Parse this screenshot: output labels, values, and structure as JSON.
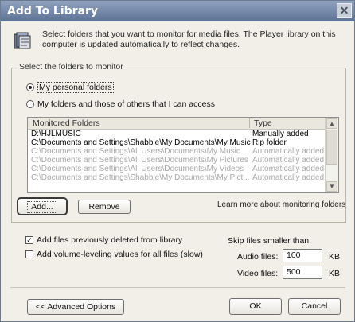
{
  "window": {
    "title": "Add To Library"
  },
  "description": "Select folders that you want to monitor for media files. The Player library on this computer is updated automatically to reflect changes.",
  "group_label": "Select the folders to monitor",
  "radios": [
    {
      "label": "My personal folders",
      "selected": true
    },
    {
      "label": "My folders and those of others that I can access",
      "selected": false
    }
  ],
  "list": {
    "headers": {
      "folder": "Monitored Folders",
      "type": "Type"
    },
    "rows": [
      {
        "folder": "D:\\HJLMUSIC",
        "type": "Manually added",
        "dim": false
      },
      {
        "folder": "C:\\Documents and Settings\\Shabble\\My Documents\\My Music",
        "type": "Rip folder",
        "dim": false
      },
      {
        "folder": "C:\\Documents and Settings\\All Users\\Documents\\My Music",
        "type": "Automatically added",
        "dim": true
      },
      {
        "folder": "C:\\Documents and Settings\\All Users\\Documents\\My Pictures",
        "type": "Automatically added",
        "dim": true
      },
      {
        "folder": "C:\\Documents and Settings\\All Users\\Documents\\My Videos",
        "type": "Automatically added",
        "dim": true
      },
      {
        "folder": "C:\\Documents and Settings\\Shabble\\My Documents\\My Pict...",
        "type": "Automatically added",
        "dim": true
      }
    ]
  },
  "buttons": {
    "add": "Add...",
    "remove": "Remove",
    "advanced": "<< Advanced Options",
    "ok": "OK",
    "cancel": "Cancel"
  },
  "link": "Learn more about monitoring folders",
  "checkboxes": [
    {
      "label": "Add files previously deleted from library",
      "checked": true
    },
    {
      "label": "Add volume-leveling values for all files (slow)",
      "checked": false
    }
  ],
  "skip": {
    "label": "Skip files smaller than:",
    "audio_label": "Audio files:",
    "audio_value": "100",
    "video_label": "Video files:",
    "video_value": "500",
    "unit": "KB"
  }
}
